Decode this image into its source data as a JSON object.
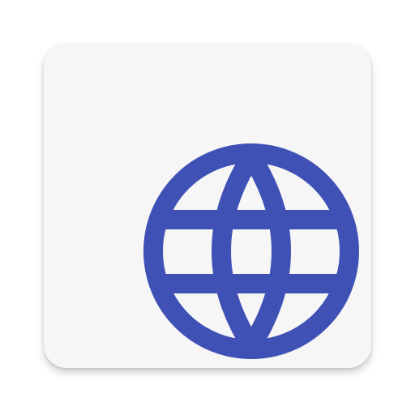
{
  "app_icon": {
    "icon": "globe-icon",
    "tile_color": "#f6f6f6",
    "icon_color": "#3f51b5"
  }
}
